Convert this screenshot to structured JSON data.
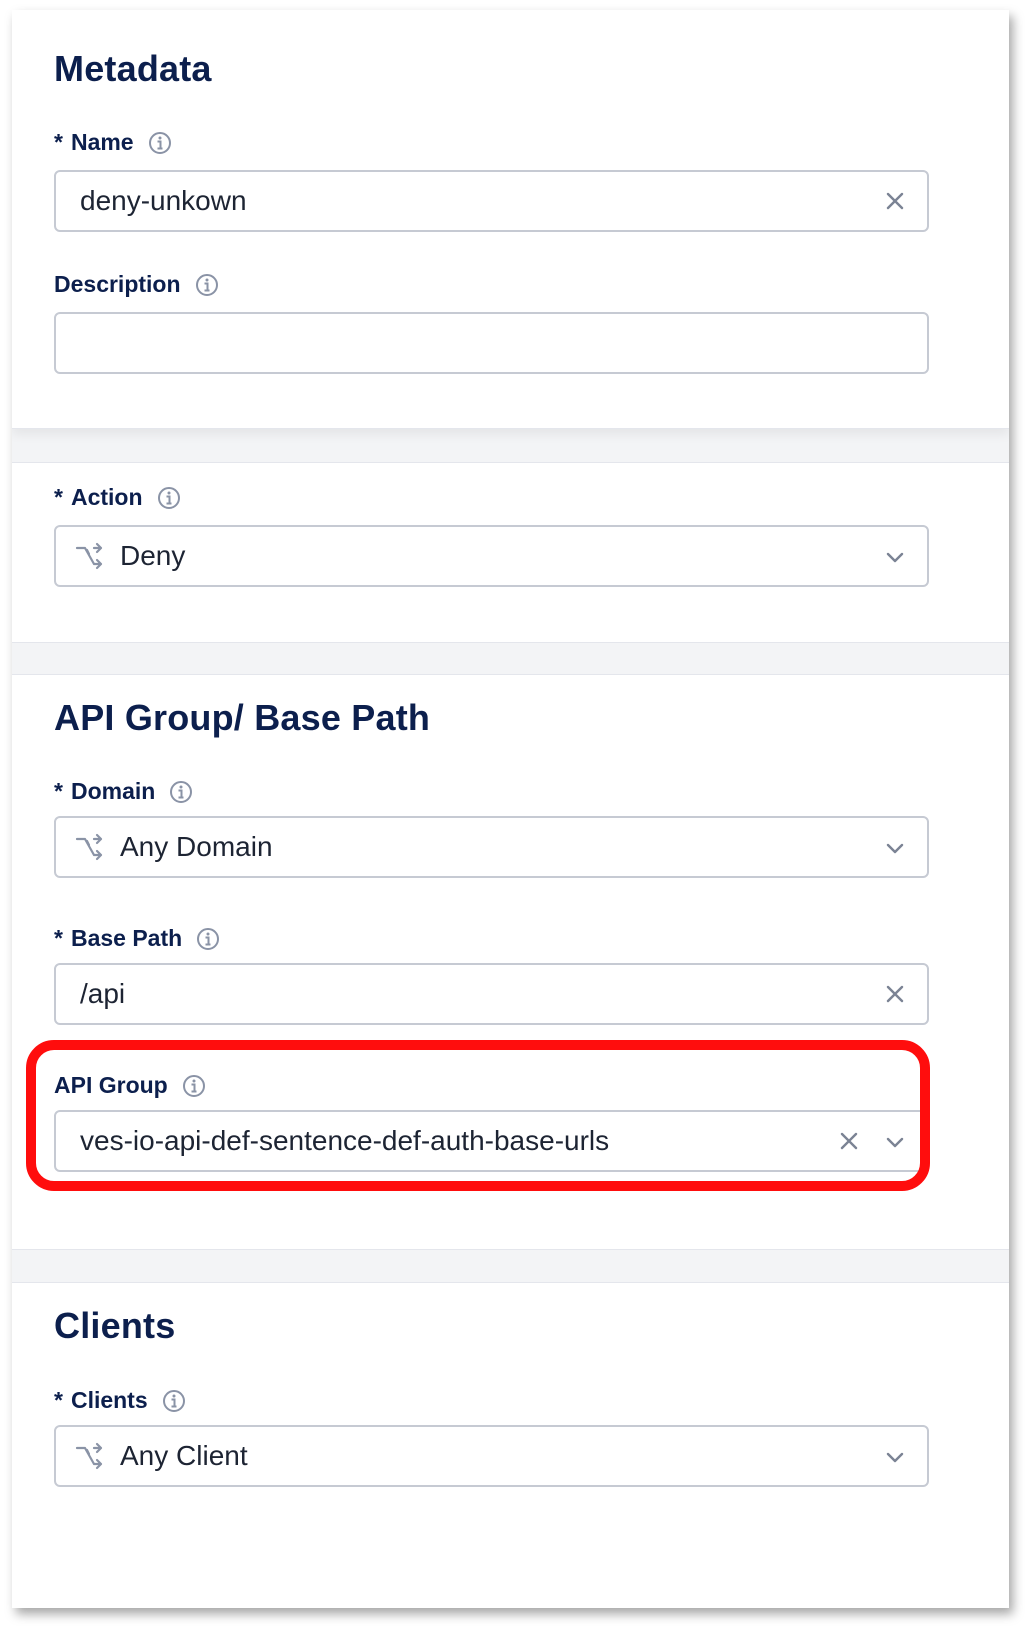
{
  "metadata": {
    "title": "Metadata",
    "name_label": "Name",
    "name_value": "deny-unkown",
    "description_label": "Description",
    "description_value": ""
  },
  "action": {
    "label": "Action",
    "value": "Deny"
  },
  "api_group_section": {
    "title": "API Group/ Base Path",
    "domain_label": "Domain",
    "domain_value": "Any Domain",
    "base_path_label": "Base Path",
    "base_path_value": "/api",
    "api_group_label": "API Group",
    "api_group_value": "ves-io-api-def-sentence-def-auth-base-urls"
  },
  "clients": {
    "title": "Clients",
    "label": "Clients",
    "value": "Any Client"
  },
  "required_marker": "*",
  "colors": {
    "heading": "#0c1f4d",
    "border": "#c6cad3",
    "highlight": "#ff0d0d"
  },
  "icons": {
    "info": "info-circle-icon",
    "clear": "close-icon",
    "dropdown": "chevron-down-icon",
    "select_lead": "switch-arrows-icon"
  }
}
